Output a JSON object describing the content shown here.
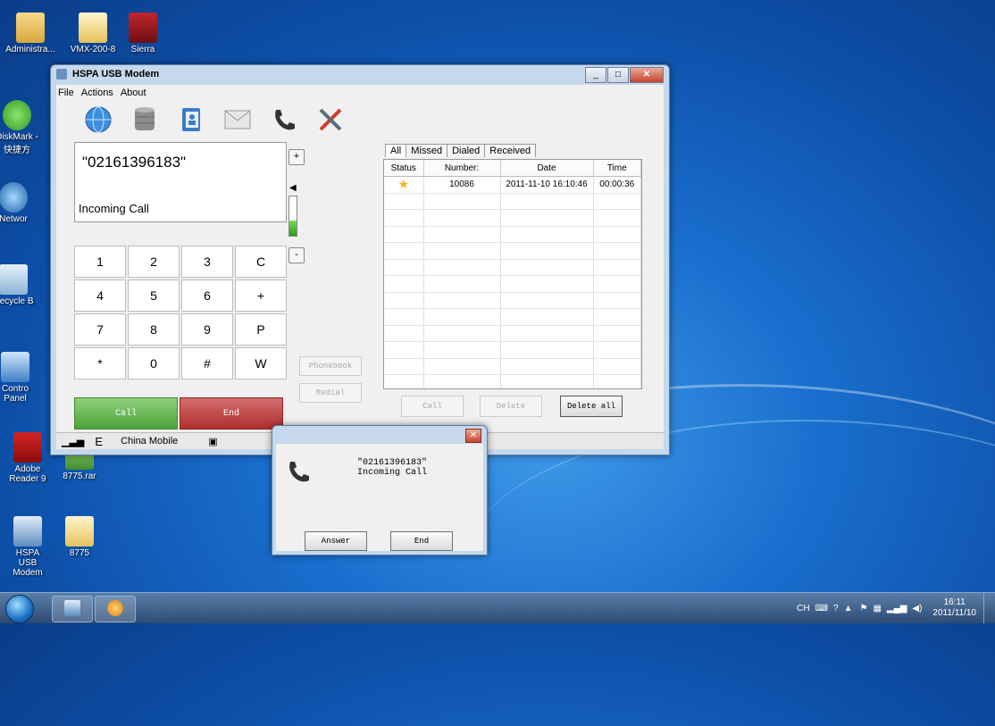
{
  "desktop": {
    "icons": [
      {
        "label": "Administra..."
      },
      {
        "label": "VMX-200-8"
      },
      {
        "label": "Sierra"
      },
      {
        "label": "DiskMark - 快捷方"
      },
      {
        "label": "Networ"
      },
      {
        "label": "Recycle B"
      },
      {
        "label": "Contro Panel"
      },
      {
        "label": "Adobe Reader 9"
      },
      {
        "label": "8775.rar"
      },
      {
        "label": "HSPA USB Modem"
      },
      {
        "label": "8775"
      }
    ]
  },
  "window": {
    "title": "HSPA USB Modem",
    "menu": [
      "File",
      "Actions",
      "About"
    ],
    "toolbar_icons": [
      "globe-icon",
      "database-icon",
      "contacts-icon",
      "envelope-icon",
      "phone-icon",
      "tools-icon"
    ]
  },
  "dialer": {
    "number": "\"02161396183\"",
    "status": "Incoming Call",
    "plus_label": "+",
    "minus_label": "-",
    "keys": [
      "1",
      "2",
      "3",
      "C",
      "4",
      "5",
      "6",
      "+",
      "7",
      "8",
      "9",
      "P",
      "*",
      "0",
      "#",
      "W"
    ],
    "call_label": "Call",
    "end_label": "End",
    "phonebook_label": "Phonebook",
    "redial_label": "Redial"
  },
  "log": {
    "tabs": [
      "All",
      "Missed",
      "Dialed",
      "Received"
    ],
    "columns": [
      "Status",
      "Number:",
      "Date",
      "Time"
    ],
    "rows": [
      {
        "number": "10086",
        "date": "2011-11-10 16:10:46",
        "time": "00:00:36"
      }
    ],
    "call_label": "Call",
    "delete_label": "Delete",
    "delete_all_label": "Delete all"
  },
  "statusbar": {
    "network_type": "E",
    "carrier": "China Mobile"
  },
  "dialog": {
    "number": "\"02161396183\"",
    "status": "Incoming Call",
    "answer_label": "Answer",
    "end_label": "End"
  },
  "tray": {
    "lang": "CH",
    "time": "16:11",
    "date": "2011/11/10"
  }
}
